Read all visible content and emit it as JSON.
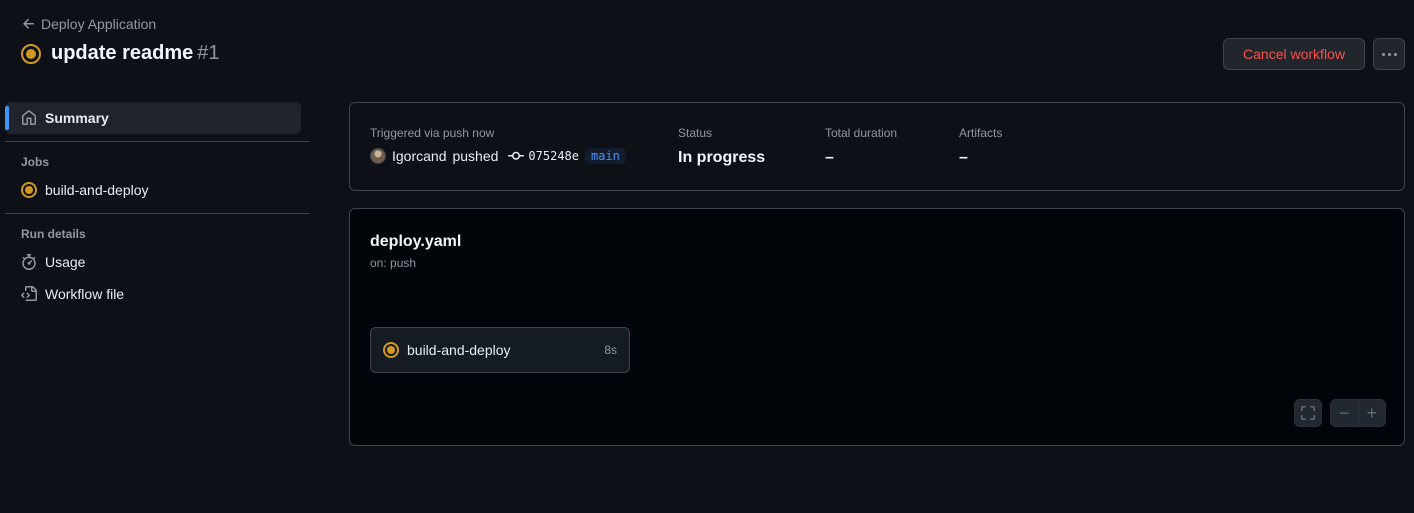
{
  "header": {
    "back_label": "Deploy Application",
    "title": "update readme",
    "run_number": "#1",
    "cancel_label": "Cancel workflow",
    "status_color": "#d29922"
  },
  "sidebar": {
    "summary_label": "Summary",
    "jobs_heading": "Jobs",
    "jobs": [
      {
        "label": "build-and-deploy",
        "status": "in_progress"
      }
    ],
    "run_details_heading": "Run details",
    "usage_label": "Usage",
    "workflow_file_label": "Workflow file"
  },
  "summary": {
    "triggered_label": "Triggered via push now",
    "actor": "Igorcand",
    "action": "pushed",
    "commit": "075248e",
    "branch": "main",
    "status_label": "Status",
    "status_value": "In progress",
    "duration_label": "Total duration",
    "duration_value": "–",
    "artifacts_label": "Artifacts",
    "artifacts_value": "–"
  },
  "graph": {
    "file": "deploy.yaml",
    "trigger": "on: push",
    "job_name": "build-and-deploy",
    "job_time": "8s",
    "zoom_out": "−",
    "zoom_in": "+"
  },
  "colors": {
    "accent": "#4493f8",
    "danger": "#f85149",
    "in_progress": "#d29922"
  }
}
